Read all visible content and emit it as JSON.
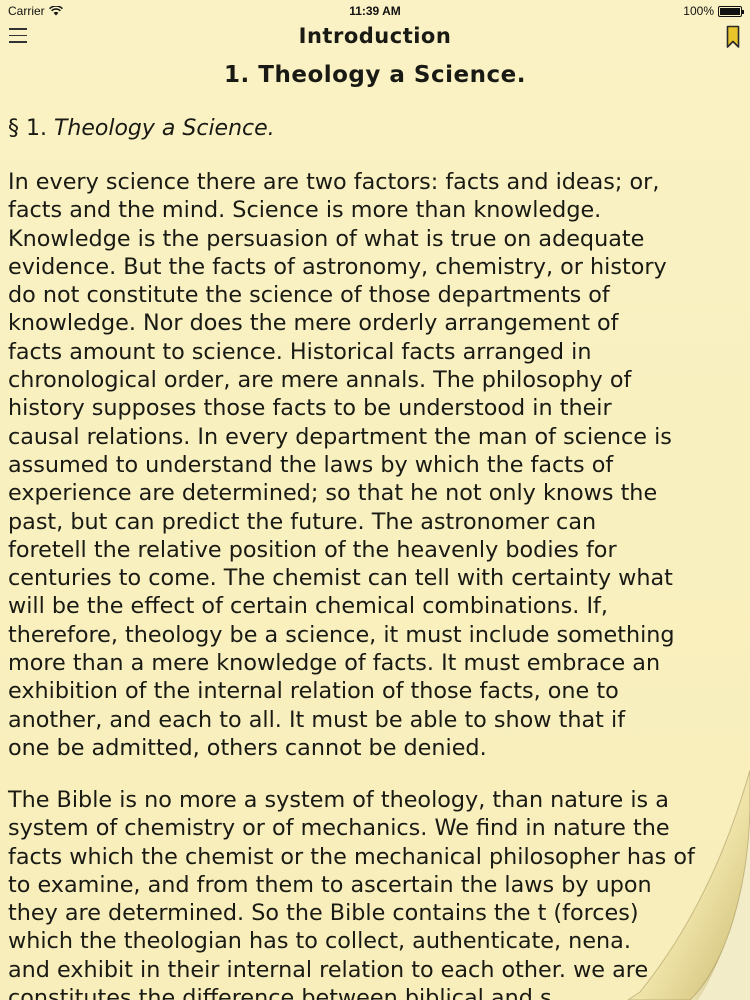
{
  "status_bar": {
    "carrier": "Carrier",
    "time": "11:39 AM",
    "battery": "100%"
  },
  "nav": {
    "title": "Introduction"
  },
  "chapter_title": "1. Theology a Science.",
  "section": {
    "number": "§ 1.",
    "title": "Theology a Science."
  },
  "paragraphs": [
    {
      "lines": [
        "In every science there are two factors: facts and ideas; or,",
        "facts and the mind. Science is more than knowledge.",
        "Knowledge is the persuasion of what is true on adequate",
        "evidence. But the facts of astronomy, chemistry, or history",
        "do not constitute the science of those departments of",
        "knowledge. Nor does the mere orderly arrangement of",
        "facts amount to science. Historical facts arranged in",
        "chronological order, are mere annals. The philosophy of",
        "history supposes those facts to be understood in their",
        "causal relations. In every department the man of science is",
        "assumed to understand the laws by which the facts of",
        "experience are determined; so that he not only knows the",
        "past, but can predict the future. The astronomer can",
        "foretell the relative position of the heavenly bodies for",
        "centuries to come. The chemist can tell with certainty what",
        "will be the effect of certain chemical combinations. If,",
        "therefore, theology be a science, it must include something",
        "more than a mere knowledge of facts. It must embrace an",
        "exhibition of the internal relation of those facts, one to",
        "another, and each to all. It must be able to show that if",
        "one be admitted, others cannot be denied."
      ]
    },
    {
      "lines": [
        "The Bible is no more a system of theology, than nature is a",
        "system of chemistry or of mechanics. We find in nature the",
        "facts which the chemist or the mechanical philosopher has of",
        "to examine, and from them to ascertain the laws by upon",
        "they are determined. So the Bible contains the t (forces)",
        "which the theologian has to collect, authenticate, nena.",
        "and exhibit in their internal relation to each other. we are",
        "constitutes the difference between biblical and s"
      ]
    }
  ],
  "colors": {
    "page_background": "#f9f0bd",
    "text": "#1a1a14",
    "bookmark": "#e8c52a"
  },
  "icons": {
    "menu": "menu-icon",
    "bookmark": "bookmark-icon",
    "wifi": "wifi-icon",
    "battery": "battery-icon"
  }
}
